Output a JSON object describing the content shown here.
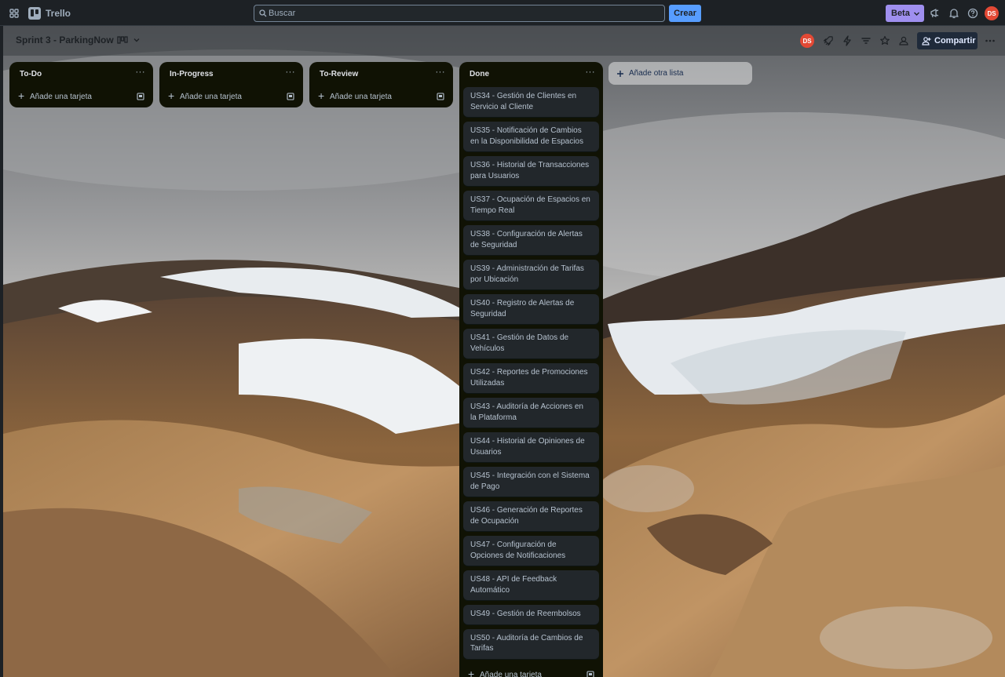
{
  "topbar": {
    "app_name": "Trello",
    "search_placeholder": "Buscar",
    "create_label": "Crear",
    "beta_label": "Beta",
    "avatar_initials": "DS"
  },
  "board": {
    "title": "Sprint 3 - ParkingNow",
    "member_initials": "DS",
    "share_label": "Compartir"
  },
  "lists": [
    {
      "title": "To-Do",
      "menu": "···",
      "cards": [],
      "add_card_label": "Añade una tarjeta"
    },
    {
      "title": "In-Progress",
      "menu": "···",
      "cards": [],
      "add_card_label": "Añade una tarjeta"
    },
    {
      "title": "To-Review",
      "menu": "···",
      "cards": [],
      "add_card_label": "Añade una tarjeta"
    },
    {
      "title": "Done",
      "menu": "···",
      "add_card_label": "Añade una tarjeta",
      "cards": [
        "US34 - Gestión de Clientes en Servicio al Cliente",
        "US35 - Notificación de Cambios en la Disponibilidad de Espacios",
        "US36 - Historial de Transacciones para Usuarios",
        "US37 - Ocupación de Espacios en Tiempo Real",
        "US38 - Configuración de Alertas de Seguridad",
        "US39 - Administración de Tarifas por Ubicación",
        "US40 - Registro de Alertas de Seguridad",
        "US41 - Gestión de Datos de Vehículos",
        "US42 - Reportes de Promociones Utilizadas",
        "US43 - Auditoría de Acciones en la Plataforma",
        "US44 - Historial de Opiniones de Usuarios",
        "US45 - Integración con el Sistema de Pago",
        "US46 - Generación de Reportes de Ocupación",
        "US47 - Configuración de Opciones de Notificaciones",
        "US48 - API de Feedback Automático",
        "US49 - Gestión de Reembolsos",
        "US50 - Auditoría de Cambios de Tarifas"
      ]
    }
  ],
  "add_list_label": "Añade otra lista",
  "colors": {
    "topbar_bg": "#1d2125",
    "list_bg": "#101204",
    "card_bg": "#22272b",
    "create_button": "#579dff",
    "beta_button": "#9f8fef",
    "avatar": "#e34935",
    "share_button": "#1f2a3a"
  },
  "icons": {
    "apps": "grid-icon",
    "logo": "trello-logo-icon",
    "search": "search-icon",
    "announcement": "megaphone-icon",
    "notifications": "bell-icon",
    "help": "help-icon",
    "board_view": "board-view-icon",
    "power_ups": "rocket-icon",
    "automation": "lightning-icon",
    "filter": "filter-icon",
    "star": "star-icon",
    "visibility": "people-icon",
    "share": "add-person-icon",
    "more": "more-icon"
  }
}
